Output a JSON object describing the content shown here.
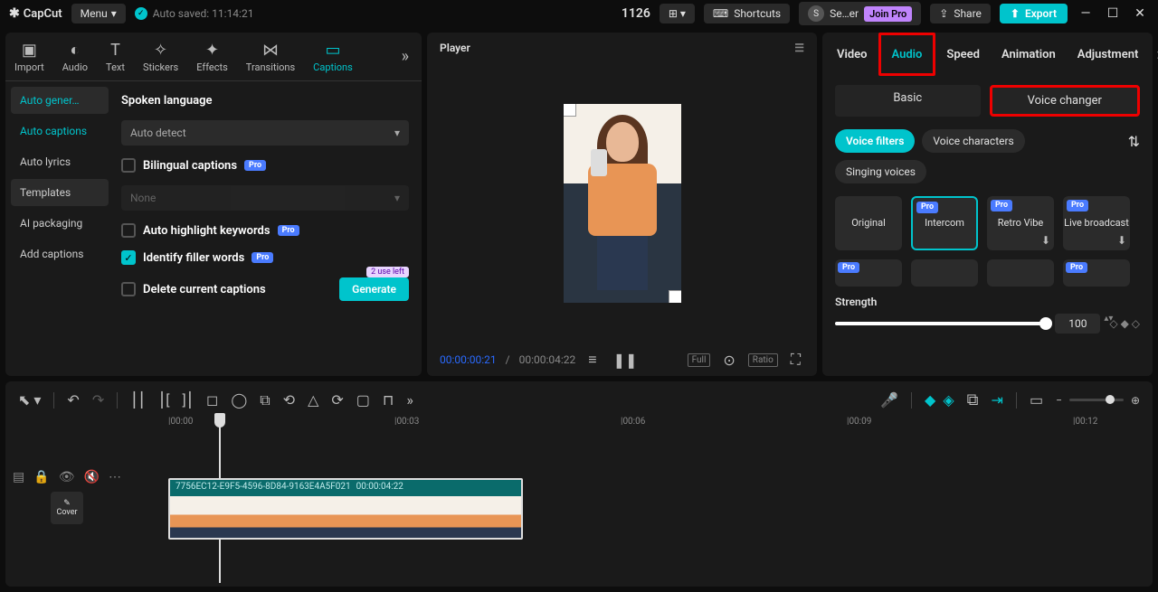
{
  "app": {
    "name": "CapCut",
    "menu": "Menu",
    "autosave": "Auto saved: 11:14:21"
  },
  "top": {
    "num": "1126",
    "shortcuts": "Shortcuts",
    "profile": "Se…er",
    "joinpro": "Join Pro",
    "share": "Share",
    "export": "Export"
  },
  "mediaTabs": [
    "Import",
    "Audio",
    "Text",
    "Stickers",
    "Effects",
    "Transitions",
    "Captions"
  ],
  "leftNav": [
    "Auto gener…",
    "Auto captions",
    "Auto lyrics",
    "Templates",
    "AI packaging",
    "Add captions"
  ],
  "captions": {
    "spokenlang": "Spoken language",
    "langval": "Auto detect",
    "bilingual": "Bilingual captions",
    "none": "None",
    "highlight": "Auto highlight keywords",
    "filler": "Identify filler words",
    "delete": "Delete current captions",
    "uses": "2 use left",
    "generate": "Generate"
  },
  "player": {
    "title": "Player",
    "cur": "00:00:00:21",
    "dur": "00:00:04:22",
    "full": "Full",
    "ratio": "Ratio"
  },
  "rtabs": [
    "Video",
    "Audio",
    "Speed",
    "Animation",
    "Adjustment"
  ],
  "rsub": {
    "basic": "Basic",
    "vc": "Voice changer"
  },
  "pills": [
    "Voice filters",
    "Voice characters",
    "Singing voices"
  ],
  "cards": [
    "Original",
    "Intercom",
    "Retro Vibe",
    "Live broadcast"
  ],
  "strength": {
    "label": "Strength",
    "val": "100"
  },
  "ruler": [
    "|00:00",
    "|00:03",
    "|00:06",
    "|00:09",
    "|00:12"
  ],
  "clip": {
    "id": "7756EC12-E9F5-4596-8D84-9163E4A5F021",
    "dur": "00:00:04:22"
  },
  "cover": "Cover"
}
